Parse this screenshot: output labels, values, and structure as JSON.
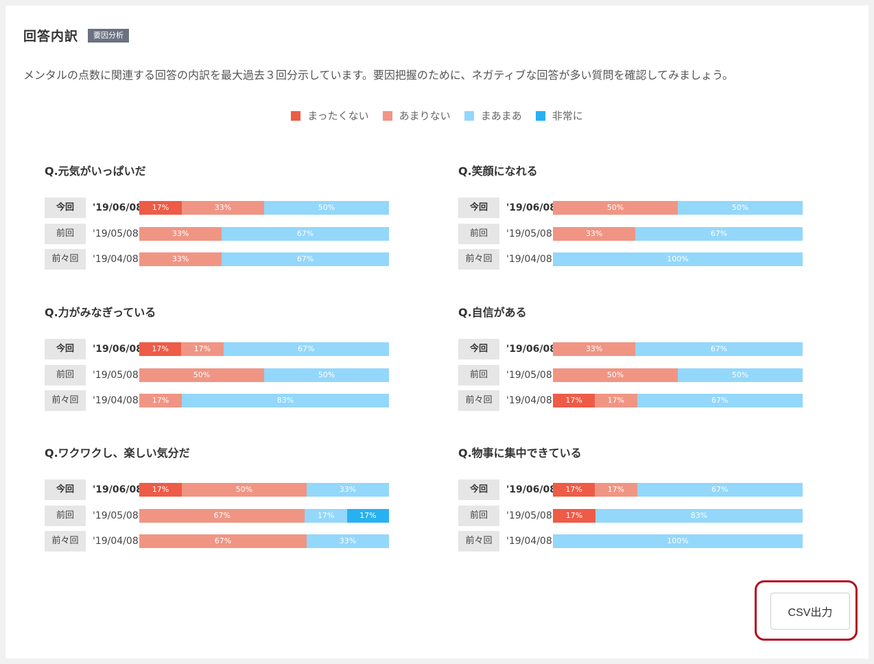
{
  "header": {
    "title": "回答内訳",
    "tag": "要因分析"
  },
  "description": "メンタルの点数に関連する回答の内訳を最大過去３回分示しています。要因把握のために、ネガティブな回答が多い質問を確認してみましょう。",
  "legend": [
    {
      "label": "まったくない",
      "color": "#ee5b47"
    },
    {
      "label": "あまりない",
      "color": "#f09584"
    },
    {
      "label": "まあまあ",
      "color": "#93d7fb"
    },
    {
      "label": "非常に",
      "color": "#28b1f2"
    }
  ],
  "questions": [
    {
      "title": "Q.元気がいっぱいだ",
      "rows": [
        {
          "label": "今回",
          "date": "'19/06/08",
          "values": [
            17,
            33,
            50,
            0
          ],
          "current": true
        },
        {
          "label": "前回",
          "date": "'19/05/08",
          "values": [
            0,
            33,
            67,
            0
          ]
        },
        {
          "label": "前々回",
          "date": "'19/04/08",
          "values": [
            0,
            33,
            67,
            0
          ]
        }
      ]
    },
    {
      "title": "Q.笑顔になれる",
      "rows": [
        {
          "label": "今回",
          "date": "'19/06/08",
          "values": [
            0,
            50,
            50,
            0
          ],
          "current": true
        },
        {
          "label": "前回",
          "date": "'19/05/08",
          "values": [
            0,
            33,
            67,
            0
          ]
        },
        {
          "label": "前々回",
          "date": "'19/04/08",
          "values": [
            0,
            0,
            100,
            0
          ]
        }
      ]
    },
    {
      "title": "Q.力がみなぎっている",
      "rows": [
        {
          "label": "今回",
          "date": "'19/06/08",
          "values": [
            17,
            17,
            67,
            0
          ],
          "current": true
        },
        {
          "label": "前回",
          "date": "'19/05/08",
          "values": [
            0,
            50,
            50,
            0
          ]
        },
        {
          "label": "前々回",
          "date": "'19/04/08",
          "values": [
            0,
            17,
            83,
            0
          ]
        }
      ]
    },
    {
      "title": "Q.自信がある",
      "rows": [
        {
          "label": "今回",
          "date": "'19/06/08",
          "values": [
            0,
            33,
            67,
            0
          ],
          "current": true
        },
        {
          "label": "前回",
          "date": "'19/05/08",
          "values": [
            0,
            50,
            50,
            0
          ]
        },
        {
          "label": "前々回",
          "date": "'19/04/08",
          "values": [
            17,
            17,
            67,
            0
          ]
        }
      ]
    },
    {
      "title": "Q.ワクワクし、楽しい気分だ",
      "rows": [
        {
          "label": "今回",
          "date": "'19/06/08",
          "values": [
            17,
            50,
            33,
            0
          ],
          "current": true
        },
        {
          "label": "前回",
          "date": "'19/05/08",
          "values": [
            0,
            67,
            17,
            17
          ]
        },
        {
          "label": "前々回",
          "date": "'19/04/08",
          "values": [
            0,
            67,
            33,
            0
          ]
        }
      ]
    },
    {
      "title": "Q.物事に集中できている",
      "rows": [
        {
          "label": "今回",
          "date": "'19/06/08",
          "values": [
            17,
            17,
            67,
            0
          ],
          "current": true
        },
        {
          "label": "前回",
          "date": "'19/05/08",
          "values": [
            17,
            0,
            83,
            0
          ]
        },
        {
          "label": "前々回",
          "date": "'19/04/08",
          "values": [
            0,
            0,
            100,
            0
          ]
        }
      ]
    }
  ],
  "csv_button": {
    "label": "CSV出力"
  }
}
